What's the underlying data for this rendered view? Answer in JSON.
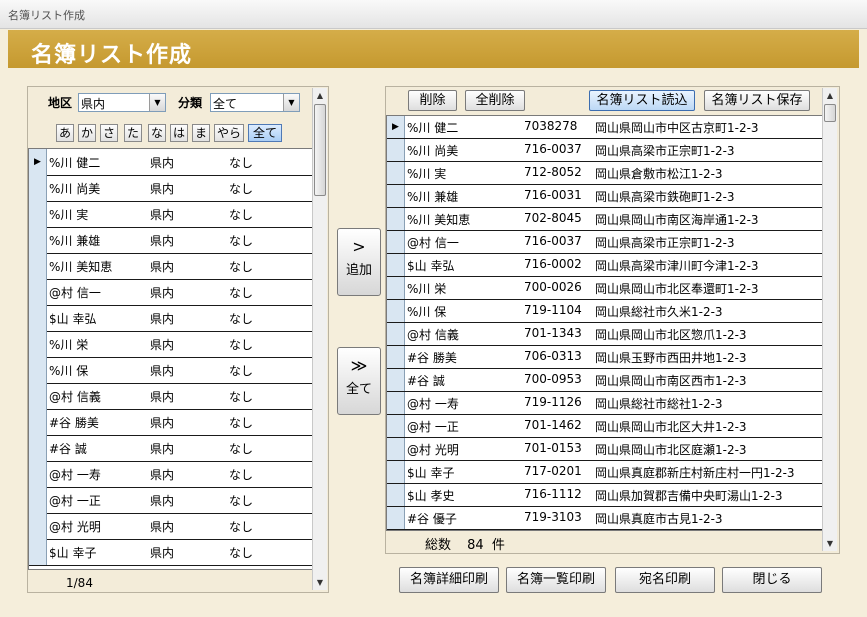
{
  "window": {
    "title": "名簿リスト作成"
  },
  "header": {
    "title": "名簿リスト作成"
  },
  "left": {
    "filter": {
      "region_label": "地区",
      "region_value": "県内",
      "category_label": "分類",
      "category_value": "全て"
    },
    "kana_buttons": [
      "あ",
      "か",
      "さ",
      "た",
      "な",
      "は",
      "ま",
      "やら",
      "全て"
    ],
    "rows": [
      {
        "name": "%川 健二",
        "region": "県内",
        "category": "なし"
      },
      {
        "name": "%川 尚美",
        "region": "県内",
        "category": "なし"
      },
      {
        "name": "%川 実",
        "region": "県内",
        "category": "なし"
      },
      {
        "name": "%川 兼雄",
        "region": "県内",
        "category": "なし"
      },
      {
        "name": "%川 美知恵",
        "region": "県内",
        "category": "なし"
      },
      {
        "name": "@村 信一",
        "region": "県内",
        "category": "なし"
      },
      {
        "name": "$山 幸弘",
        "region": "県内",
        "category": "なし"
      },
      {
        "name": "%川 栄",
        "region": "県内",
        "category": "なし"
      },
      {
        "name": "%川 保",
        "region": "県内",
        "category": "なし"
      },
      {
        "name": "@村 信義",
        "region": "県内",
        "category": "なし"
      },
      {
        "name": "#谷 勝美",
        "region": "県内",
        "category": "なし"
      },
      {
        "name": "#谷 誠",
        "region": "県内",
        "category": "なし"
      },
      {
        "name": "@村 一寿",
        "region": "県内",
        "category": "なし"
      },
      {
        "name": "@村 一正",
        "region": "県内",
        "category": "なし"
      },
      {
        "name": "@村 光明",
        "region": "県内",
        "category": "なし"
      },
      {
        "name": "$山 幸子",
        "region": "県内",
        "category": "なし"
      }
    ],
    "record_counter": "1/84"
  },
  "middle": {
    "add_button": {
      "glyph": ">",
      "label": "追加"
    },
    "add_all_button": {
      "glyph": "≫",
      "label": "全て"
    }
  },
  "right": {
    "toolbar": {
      "delete": "削除",
      "delete_all": "全削除",
      "load": "名簿リスト読込",
      "save": "名簿リスト保存"
    },
    "rows": [
      {
        "name": "%川 健二",
        "zip": "7038278",
        "address": "岡山県岡山市中区古京町1-2-3"
      },
      {
        "name": "%川 尚美",
        "zip": "716-0037",
        "address": "岡山県高梁市正宗町1-2-3"
      },
      {
        "name": "%川 実",
        "zip": "712-8052",
        "address": "岡山県倉敷市松江1-2-3"
      },
      {
        "name": "%川 兼雄",
        "zip": "716-0031",
        "address": "岡山県高梁市鉄砲町1-2-3"
      },
      {
        "name": "%川 美知恵",
        "zip": "702-8045",
        "address": "岡山県岡山市南区海岸通1-2-3"
      },
      {
        "name": "@村 信一",
        "zip": "716-0037",
        "address": "岡山県高梁市正宗町1-2-3"
      },
      {
        "name": "$山 幸弘",
        "zip": "716-0002",
        "address": "岡山県高梁市津川町今津1-2-3"
      },
      {
        "name": "%川 栄",
        "zip": "700-0026",
        "address": "岡山県岡山市北区奉還町1-2-3"
      },
      {
        "name": "%川 保",
        "zip": "719-1104",
        "address": "岡山県総社市久米1-2-3"
      },
      {
        "name": "@村 信義",
        "zip": "701-1343",
        "address": "岡山県岡山市北区惣爪1-2-3"
      },
      {
        "name": "#谷 勝美",
        "zip": "706-0313",
        "address": "岡山県玉野市西田井地1-2-3"
      },
      {
        "name": "#谷 誠",
        "zip": "700-0953",
        "address": "岡山県岡山市南区西市1-2-3"
      },
      {
        "name": "@村 一寿",
        "zip": "719-1126",
        "address": "岡山県総社市総社1-2-3"
      },
      {
        "name": "@村 一正",
        "zip": "701-1462",
        "address": "岡山県岡山市北区大井1-2-3"
      },
      {
        "name": "@村 光明",
        "zip": "701-0153",
        "address": "岡山県岡山市北区庭瀬1-2-3"
      },
      {
        "name": "$山 幸子",
        "zip": "717-0201",
        "address": "岡山県真庭郡新庄村新庄村一円1-2-3"
      },
      {
        "name": "$山 孝史",
        "zip": "716-1112",
        "address": "岡山県加賀郡吉備中央町湯山1-2-3"
      },
      {
        "name": "#谷 優子",
        "zip": "719-3103",
        "address": "岡山県真庭市古見1-2-3"
      }
    ],
    "total_label": "総数",
    "total_count": "84",
    "total_unit": "件"
  },
  "footer": {
    "detail_print": "名簿詳細印刷",
    "list_print": "名簿一覧印刷",
    "label_print": "宛名印刷",
    "close": "閉じる"
  }
}
